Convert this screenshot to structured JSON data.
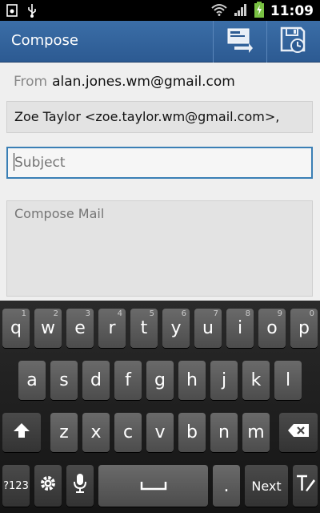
{
  "status_bar": {
    "time": "11:09",
    "icons": [
      "screenshot-icon",
      "usb-icon",
      "wifi-icon",
      "signal-icon",
      "battery-charging-icon"
    ],
    "battery_color": "#7ac143"
  },
  "action_bar": {
    "title": "Compose",
    "background": "#2f5f98",
    "actions": [
      "send-icon",
      "save-draft-icon"
    ]
  },
  "compose": {
    "from_label": "From",
    "from_address": "alan.jones.wm@gmail.com",
    "to_value": "Zoe Taylor <zoe.taylor.wm@gmail.com>,",
    "subject_placeholder": "Subject",
    "body_placeholder": "Compose Mail",
    "focus_color": "#3a7fb5"
  },
  "keyboard": {
    "row1": [
      {
        "label": "q",
        "hint": "1"
      },
      {
        "label": "w",
        "hint": "2"
      },
      {
        "label": "e",
        "hint": "3"
      },
      {
        "label": "r",
        "hint": "4"
      },
      {
        "label": "t",
        "hint": "5"
      },
      {
        "label": "y",
        "hint": "6"
      },
      {
        "label": "u",
        "hint": "7"
      },
      {
        "label": "i",
        "hint": "8"
      },
      {
        "label": "o",
        "hint": "9"
      },
      {
        "label": "p",
        "hint": "0"
      }
    ],
    "row2": [
      "a",
      "s",
      "d",
      "f",
      "g",
      "h",
      "j",
      "k",
      "l"
    ],
    "row3": [
      "z",
      "x",
      "c",
      "v",
      "b",
      "n",
      "m"
    ],
    "symbols_label": "?123",
    "period_label": ".",
    "next_label": "Next",
    "icons": [
      "shift-icon",
      "backspace-icon",
      "settings-icon",
      "microphone-icon",
      "space-icon",
      "text-style-icon"
    ]
  }
}
